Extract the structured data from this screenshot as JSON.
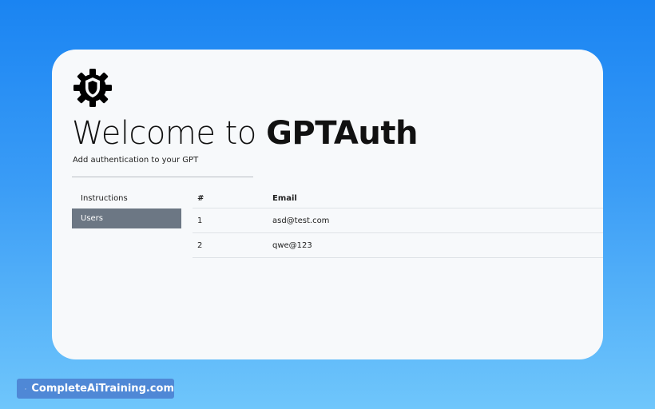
{
  "header": {
    "title_prefix": "Welcome to ",
    "title_brand": "GPTAuth",
    "subtitle": "Add authentication to your GPT"
  },
  "nav": {
    "items": [
      {
        "label": "Instructions",
        "active": false
      },
      {
        "label": "Users",
        "active": true
      }
    ]
  },
  "users_table": {
    "columns": [
      "#",
      "Email"
    ],
    "rows": [
      {
        "num": "1",
        "email": "asd@test.com"
      },
      {
        "num": "2",
        "email": "qwe@123"
      }
    ]
  },
  "watermark": {
    "text": "CompleteAiTraining.com",
    "icon": "spark-icon"
  },
  "colors": {
    "background_top": "#1a84f2",
    "background_bottom": "#6fc6fb",
    "card": "#f7f9fb",
    "nav_active": "#6c7784",
    "badge": "#4f88d6"
  },
  "logo": {
    "icon": "shield-gear-icon"
  }
}
